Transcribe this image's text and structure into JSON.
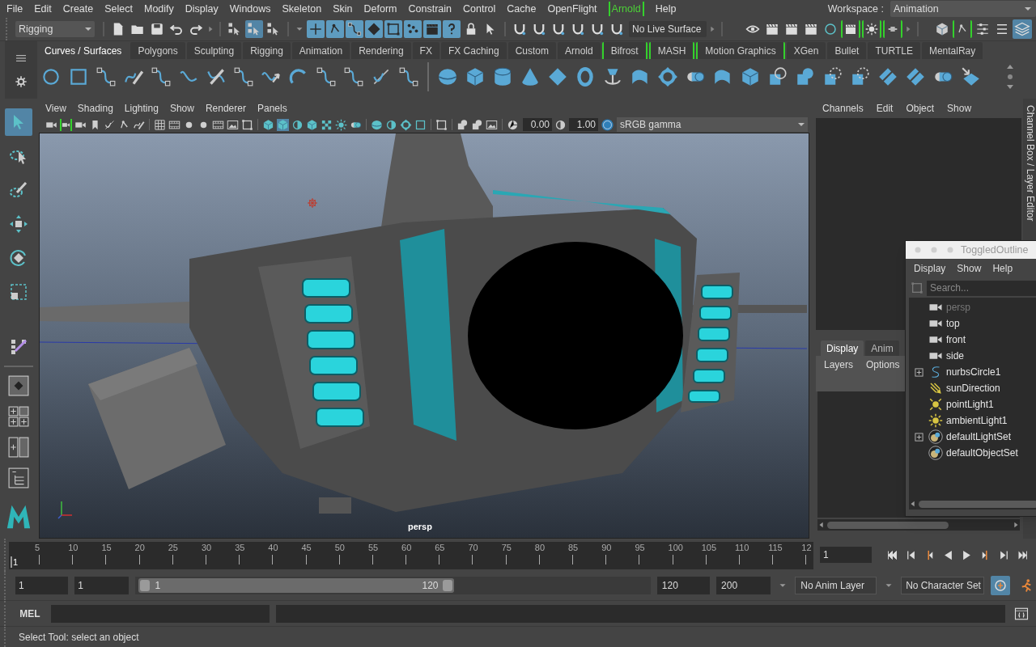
{
  "menu_bar": {
    "items": [
      {
        "label": "File",
        "bracketed": false
      },
      {
        "label": "Edit",
        "bracketed": false
      },
      {
        "label": "Create",
        "bracketed": false
      },
      {
        "label": "Select",
        "bracketed": false
      },
      {
        "label": "Modify",
        "bracketed": false
      },
      {
        "label": "Display",
        "bracketed": false
      },
      {
        "label": "Windows",
        "bracketed": false
      },
      {
        "label": "Skeleton",
        "bracketed": false
      },
      {
        "label": "Skin",
        "bracketed": false
      },
      {
        "label": "Deform",
        "bracketed": false
      },
      {
        "label": "Constrain",
        "bracketed": false
      },
      {
        "label": "Control",
        "bracketed": false
      },
      {
        "label": "Cache",
        "bracketed": false
      },
      {
        "label": "OpenFlight",
        "bracketed": false
      },
      {
        "label": "Arnold",
        "bracketed": true
      },
      {
        "label": "Help",
        "bracketed": false
      }
    ],
    "workspace_label": "Workspace :",
    "workspace": "Animation"
  },
  "status_line": {
    "menu_set": "Rigging",
    "live_surface": "No Live Surface"
  },
  "shelf": {
    "tabs": [
      {
        "label": "Curves / Surfaces",
        "selected": true,
        "bracketed": false
      },
      {
        "label": "Polygons",
        "selected": false,
        "bracketed": false
      },
      {
        "label": "Sculpting",
        "selected": false,
        "bracketed": false
      },
      {
        "label": "Rigging",
        "selected": false,
        "bracketed": false
      },
      {
        "label": "Animation",
        "selected": false,
        "bracketed": false
      },
      {
        "label": "Rendering",
        "selected": false,
        "bracketed": false
      },
      {
        "label": "FX",
        "selected": false,
        "bracketed": false
      },
      {
        "label": "FX Caching",
        "selected": false,
        "bracketed": false
      },
      {
        "label": "Custom",
        "selected": false,
        "bracketed": false
      },
      {
        "label": "Arnold",
        "selected": false,
        "bracketed": false
      },
      {
        "label": "Bifrost",
        "selected": false,
        "bracketed": true
      },
      {
        "label": "MASH",
        "selected": false,
        "bracketed": true
      },
      {
        "label": "Motion Graphics",
        "selected": false,
        "bracketed": true
      },
      {
        "label": "XGen",
        "selected": false,
        "bracketed": false
      },
      {
        "label": "Bullet",
        "selected": false,
        "bracketed": false
      },
      {
        "label": "TURTLE",
        "selected": false,
        "bracketed": false
      },
      {
        "label": "MentalRay",
        "selected": false,
        "bracketed": false
      }
    ]
  },
  "toolbox": {
    "tools": [
      {
        "selected": true
      },
      {
        "selected": false
      },
      {
        "selected": false
      },
      {
        "selected": false
      },
      {
        "selected": false
      },
      {
        "selected": false
      }
    ]
  },
  "viewport": {
    "menu": [
      "View",
      "Shading",
      "Lighting",
      "Show",
      "Renderer",
      "Panels"
    ],
    "exposure": "0.00",
    "gamma": "1.00",
    "color_space": "sRGB gamma",
    "camera_label": "persp"
  },
  "channel_box": {
    "menu": [
      "Channels",
      "Edit",
      "Object",
      "Show"
    ],
    "side_tab": "Channel Box / Layer Editor"
  },
  "layer_editor": {
    "tabs": [
      {
        "label": "Display",
        "selected": true
      },
      {
        "label": "Anim",
        "selected": false
      }
    ],
    "menu": [
      "Layers",
      "Options"
    ]
  },
  "outliner": {
    "title": "ToggledOutline",
    "menu": [
      "Display",
      "Show",
      "Help"
    ],
    "search": {
      "placeholder": "Search..."
    },
    "items": [
      {
        "label": "persp",
        "kind": "camera",
        "dimmed": true,
        "expandable": false
      },
      {
        "label": "top",
        "kind": "camera",
        "dimmed": false,
        "expandable": false
      },
      {
        "label": "front",
        "kind": "camera",
        "dimmed": false,
        "expandable": false
      },
      {
        "label": "side",
        "kind": "camera",
        "dimmed": false,
        "expandable": false
      },
      {
        "label": "nurbsCircle1",
        "kind": "curve",
        "dimmed": false,
        "expandable": true
      },
      {
        "label": "sunDirection",
        "kind": "directional_light",
        "dimmed": false,
        "expandable": false
      },
      {
        "label": "pointLight1",
        "kind": "point_light",
        "dimmed": false,
        "expandable": false
      },
      {
        "label": "ambientLight1",
        "kind": "ambient_light",
        "dimmed": false,
        "expandable": false
      },
      {
        "label": "defaultLightSet",
        "kind": "set",
        "dimmed": false,
        "expandable": true
      },
      {
        "label": "defaultObjectSet",
        "kind": "set",
        "dimmed": false,
        "expandable": false
      }
    ]
  },
  "time_slider": {
    "current_marker": "1",
    "ticks": [
      "5",
      "10",
      "15",
      "20",
      "25",
      "30",
      "35",
      "40",
      "45",
      "50",
      "55",
      "60",
      "65",
      "70",
      "75",
      "80",
      "85",
      "90",
      "95",
      "100",
      "105",
      "110",
      "115",
      "12"
    ],
    "current_frame": "1"
  },
  "range_slider": {
    "start": "1",
    "playback_start": "1",
    "range_start": "1",
    "range_end": "120",
    "playback_end": "120",
    "end": "200",
    "anim_layer": "No Anim Layer",
    "character_set": "No Character Set"
  },
  "command_line": {
    "language": "MEL"
  },
  "help_line": "Select Tool: select an object"
}
